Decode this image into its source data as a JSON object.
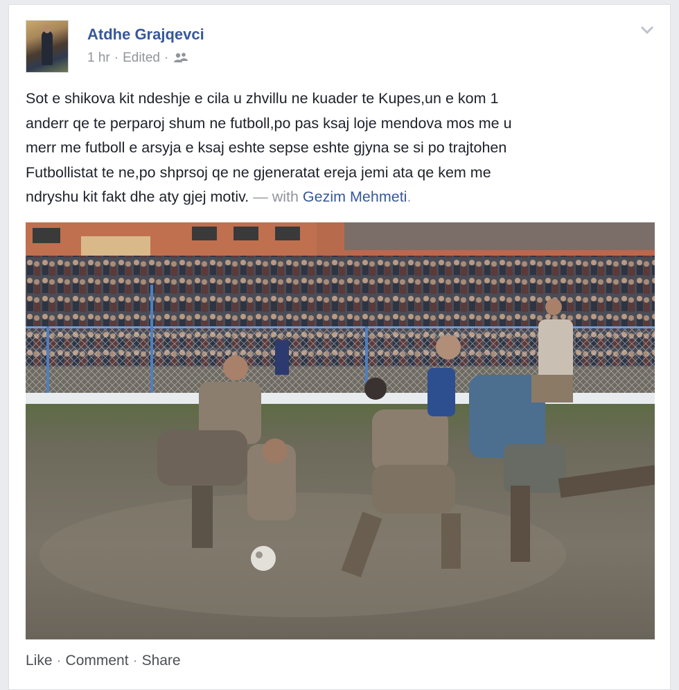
{
  "post": {
    "author": "Atdhe Grajqevci",
    "time": "1 hr",
    "edited": "Edited",
    "sep1": "·",
    "sep2": "·",
    "text_lines": [
      "Sot e shikova kit ndeshje e cila u zhvillu ne kuader te Kupes,un e kom 1",
      "anderr qe te perparoj shum ne futboll,po pas ksaj loje mendova mos me u",
      "merr me futboll e arsyja e ksaj eshte sepse eshte gjyna se si po trajtohen",
      "Futbollistat te ne,po shprsoj qe ne gjeneratat ereja jemi ata qe kem me",
      "ndryshu kit fakt dhe aty gjej motiv."
    ],
    "with_prefix": " — with ",
    "tagged": "Gezim Mehmeti",
    "tag_suffix": ".",
    "photo_label": "muddy football match photo"
  },
  "actions": {
    "like": "Like",
    "comment": "Comment",
    "share": "Share",
    "sep": "·"
  },
  "icons": {
    "audience": "friends-icon",
    "menu": "chevron-down-icon"
  },
  "colors": {
    "link": "#365899",
    "meta": "#90949c",
    "text": "#1d2129"
  }
}
